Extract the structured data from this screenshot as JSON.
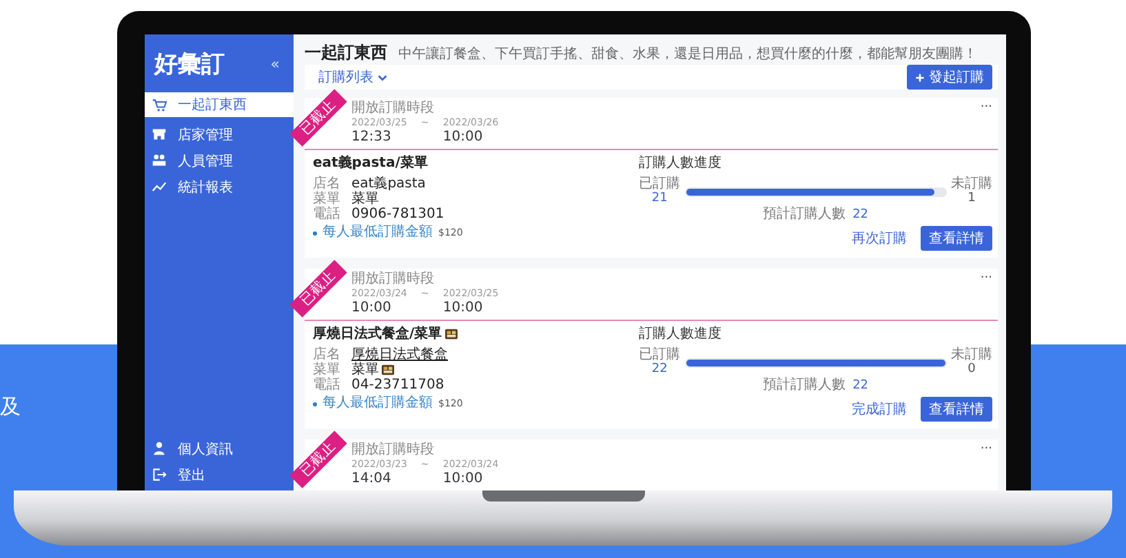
{
  "background_text": "及",
  "app": {
    "logo": "好彙訂",
    "collapse": "«",
    "nav": [
      {
        "label": "一起訂東西",
        "selected": true
      },
      {
        "label": "店家管理",
        "selected": false
      },
      {
        "label": "人員管理",
        "selected": false
      },
      {
        "label": "統計報表",
        "selected": false
      }
    ],
    "nav_bottom": [
      {
        "label": "個人資訊"
      },
      {
        "label": "登出"
      }
    ]
  },
  "page": {
    "title": "一起訂東西",
    "subtitle": "中午讓訂餐盒、下午買訂手搖、甜食、水果，還是日用品，想買什麼的什麼，都能幫朋友團購！"
  },
  "toolbar": {
    "filter": "訂購列表",
    "new_button": "發起訂購"
  },
  "orders": [
    {
      "status": "已截止",
      "period_label": "開放訂購時段",
      "start_date": "2022/03/25",
      "start_time": "12:33",
      "separator": "~",
      "end_date": "2022/03/26",
      "end_time": "10:00",
      "more": "···",
      "title": "eat義pasta/菜單",
      "title_icon": false,
      "fields": [
        {
          "label": "店名",
          "value": "eat義pasta",
          "link": false,
          "value_icon": false
        },
        {
          "label": "菜單",
          "value": "菜單",
          "link": false,
          "value_icon": false
        },
        {
          "label": "電話",
          "value": "0906-781301",
          "link": false,
          "value_icon": false
        }
      ],
      "min_amount_label": "每人最低訂購金額",
      "min_amount": "$120",
      "progress": {
        "title": "訂購人數進度",
        "ordered_label": "已訂購",
        "ordered": "21",
        "level": 0.96,
        "not_ordered_label": "未訂購",
        "not_ordered": "1",
        "expected_label": "預計訂購人數",
        "expected": "22"
      },
      "secondary_action": "再次訂購",
      "primary_action": "查看詳情"
    },
    {
      "status": "已截止",
      "period_label": "開放訂購時段",
      "start_date": "2022/03/24",
      "start_time": "10:00",
      "separator": "~",
      "end_date": "2022/03/25",
      "end_time": "10:00",
      "more": "···",
      "title": "厚燒日法式餐盒/菜單",
      "title_icon": true,
      "fields": [
        {
          "label": "店名",
          "value": "厚燒日法式餐盒",
          "link": true,
          "value_icon": false
        },
        {
          "label": "菜單",
          "value": "菜單",
          "link": false,
          "value_icon": true
        },
        {
          "label": "電話",
          "value": "04-23711708",
          "link": false,
          "value_icon": false
        }
      ],
      "min_amount_label": "每人最低訂購金額",
      "min_amount": "$120",
      "progress": {
        "title": "訂購人數進度",
        "ordered_label": "已訂購",
        "ordered": "22",
        "level": 1,
        "not_ordered_label": "未訂購",
        "not_ordered": "0",
        "expected_label": "預計訂購人數",
        "expected": "22"
      },
      "secondary_action": "完成訂購",
      "primary_action": "查看詳情"
    },
    {
      "status": "已截止",
      "period_label": "開放訂購時段",
      "start_date": "2022/03/23",
      "start_time": "14:04",
      "separator": "~",
      "end_date": "2022/03/24",
      "end_time": "10:00",
      "more": "···"
    }
  ]
}
